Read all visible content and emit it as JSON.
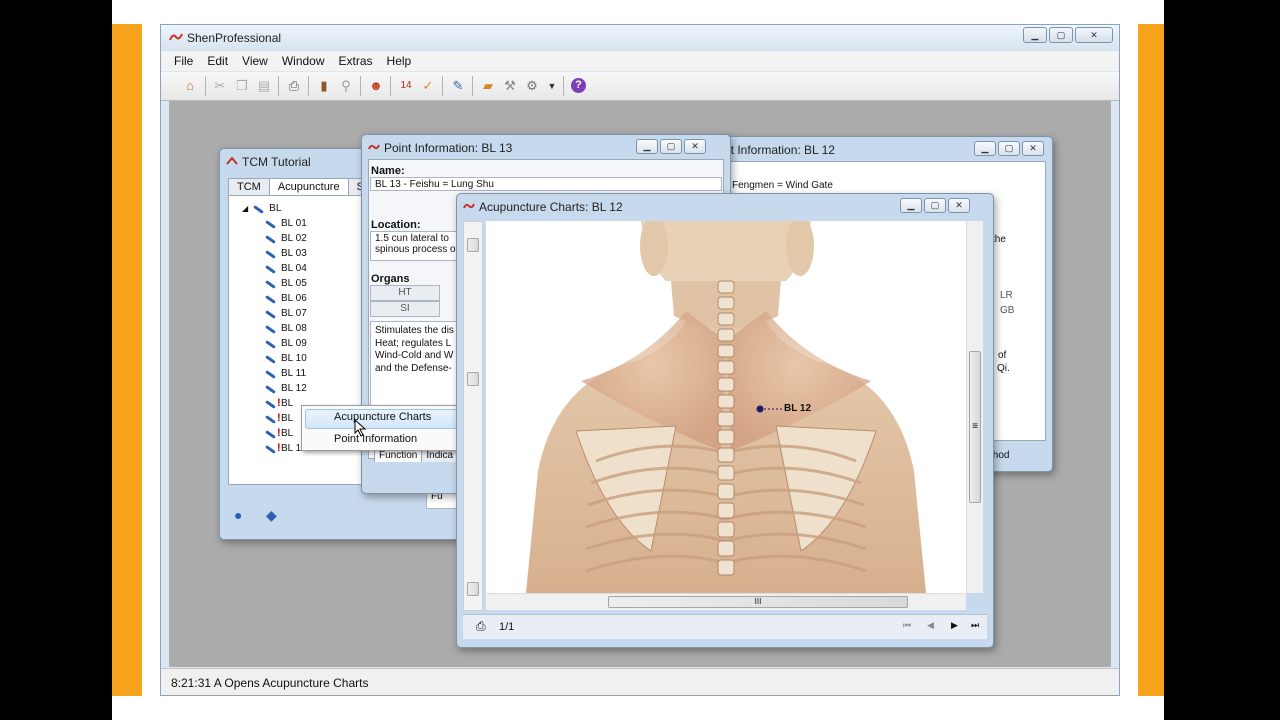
{
  "app": {
    "title": "ShenProfessional",
    "menu": [
      "File",
      "Edit",
      "View",
      "Window",
      "Extras",
      "Help"
    ],
    "toolbar_icons": [
      "home-icon",
      "cut-icon",
      "copy-icon",
      "paste-icon",
      "print-icon",
      "book-icon",
      "book-link-icon",
      "patient-icon",
      "calendar-icon",
      "check-calendar-icon",
      "search-icon",
      "notebook-icon",
      "tools-icon",
      "settings-icon",
      "dropdown-icon",
      "help-icon"
    ],
    "status_text": "8:21:31 A  Opens Acupuncture Charts"
  },
  "tutorial": {
    "title": "TCM Tutorial",
    "tabs": [
      "TCM",
      "Acupuncture",
      "Syr"
    ],
    "root": "BL",
    "items": [
      "BL 01",
      "BL 02",
      "BL 03",
      "BL 04",
      "BL 05",
      "BL 06",
      "BL 07",
      "BL 08",
      "BL 09",
      "BL 10",
      "BL 11",
      "BL 12",
      "BL",
      "BL",
      "BL",
      "BL 16"
    ],
    "bottom_tab": "Fu"
  },
  "point13": {
    "title": "Point Information: BL 13",
    "name_label": "Name:",
    "name_value": "BL 13 - Feishu = Lung Shu",
    "location_label": "Location:",
    "location_line1": "1.5 cun lateral to",
    "location_line2": "spinous process o",
    "organs_label": "Organs",
    "organs": [
      "HT",
      "SI"
    ],
    "function_lines": [
      "Stimulates the dis",
      "Heat; regulates L",
      "Wind-Cold and W",
      "and the Defense-"
    ],
    "tabs": [
      "Function",
      "Indica"
    ]
  },
  "point12": {
    "title": "at Information: BL 12",
    "name_value": "Fengmen = Wind Gate",
    "location_tail": "the",
    "organs": [
      "LR",
      "GB"
    ],
    "function_tail": [
      "of",
      "i Qi."
    ],
    "tab_right": "thod"
  },
  "context_menu": {
    "items": [
      "Acupuncture Charts",
      "Point Information"
    ]
  },
  "chart": {
    "title": "Acupuncture Charts: BL 12",
    "point_label": "BL 12",
    "page": "1/1",
    "scroll_grip": "III",
    "vgrip": "≡"
  },
  "colors": {
    "accent_orange": "#f7a21b",
    "window_frame": "#c7d9ec",
    "workspace": "#ababab"
  }
}
